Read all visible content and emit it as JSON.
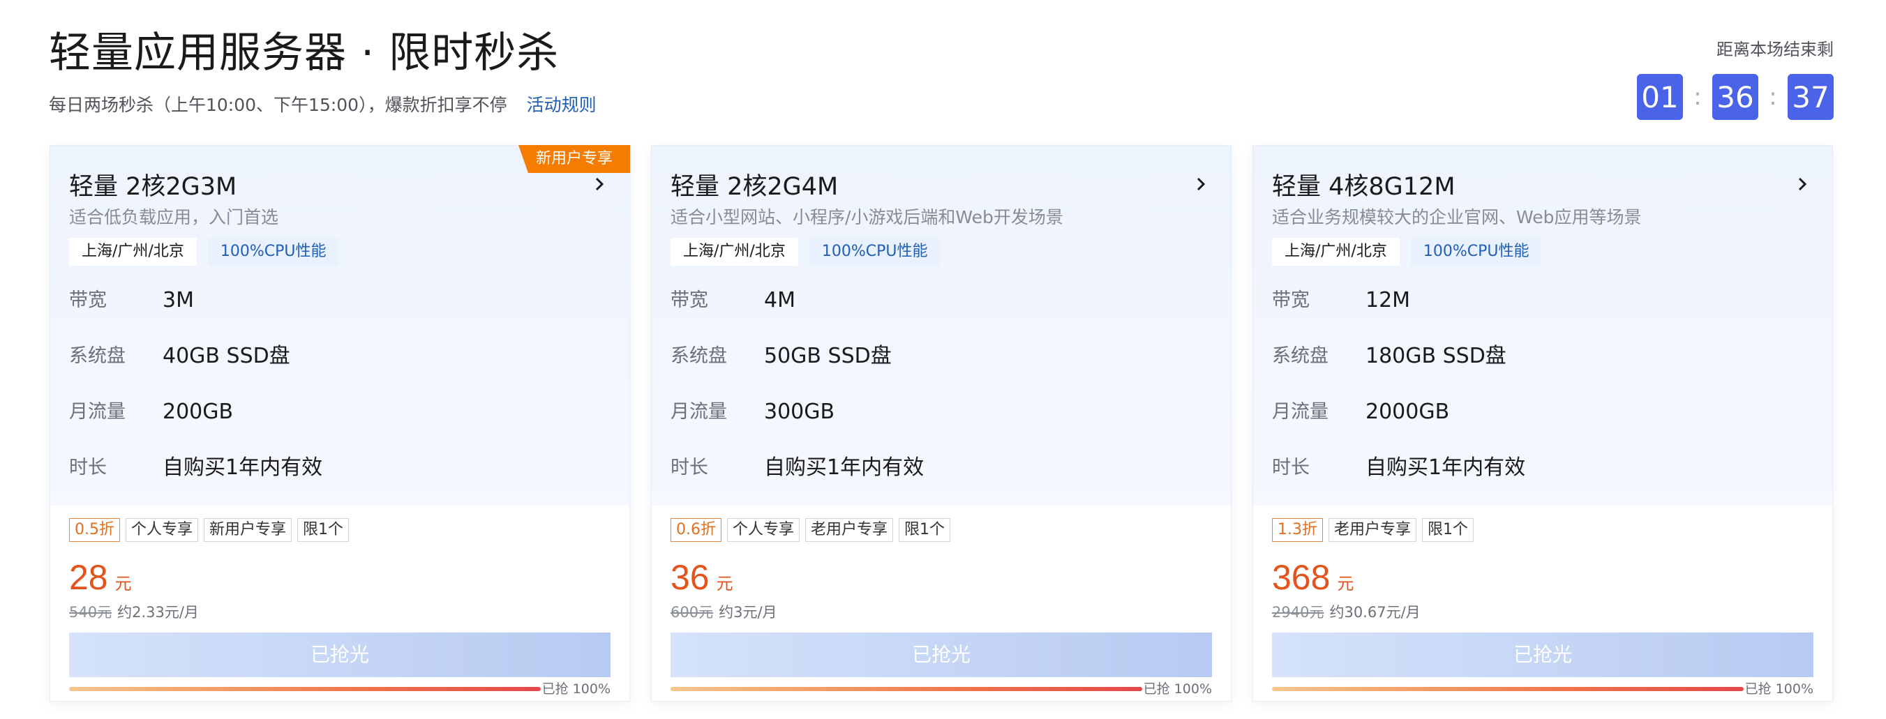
{
  "header": {
    "title": "轻量应用服务器 · 限时秒杀",
    "subtitle": "每日两场秒杀（上午10:00、下午15:00），爆款折扣享不停",
    "rules_link": "活动规则"
  },
  "countdown": {
    "label": "距离本场结束剩",
    "hours": "01",
    "minutes": "36",
    "seconds": "37",
    "separator": ":"
  },
  "colors": {
    "accent": "#4a63e8",
    "price": "#e5531c",
    "ribbon": "#f57c00",
    "link": "#1f5fb5"
  },
  "spec_labels": {
    "bandwidth": "带宽",
    "disk": "系统盘",
    "traffic": "月流量",
    "duration": "时长"
  },
  "cards": [
    {
      "ribbon": "新用户专享",
      "name": "轻量 2核2G3M",
      "desc": "适合低负载应用，入门首选",
      "tag_location": "上海/广州/北京",
      "tag_cpu": "100%CPU性能",
      "bandwidth": "3M",
      "disk": "40GB SSD盘",
      "traffic": "200GB",
      "duration": "自购买1年内有效",
      "badges": [
        "0.5折",
        "个人专享",
        "新用户专享",
        "限1个"
      ],
      "price": "28",
      "price_unit": "元",
      "original_price": "540元",
      "monthly": "约2.33元/月",
      "button": "已抢光",
      "progress": 1.0,
      "progress_text": "已抢 100%"
    },
    {
      "ribbon": "",
      "name": "轻量 2核2G4M",
      "desc": "适合小型网站、小程序/小游戏后端和Web开发场景",
      "tag_location": "上海/广州/北京",
      "tag_cpu": "100%CPU性能",
      "bandwidth": "4M",
      "disk": "50GB SSD盘",
      "traffic": "300GB",
      "duration": "自购买1年内有效",
      "badges": [
        "0.6折",
        "个人专享",
        "老用户专享",
        "限1个"
      ],
      "price": "36",
      "price_unit": "元",
      "original_price": "600元",
      "monthly": "约3元/月",
      "button": "已抢光",
      "progress": 1.0,
      "progress_text": "已抢 100%"
    },
    {
      "ribbon": "",
      "name": "轻量 4核8G12M",
      "desc": "适合业务规模较大的企业官网、Web应用等场景",
      "tag_location": "上海/广州/北京",
      "tag_cpu": "100%CPU性能",
      "bandwidth": "12M",
      "disk": "180GB SSD盘",
      "traffic": "2000GB",
      "duration": "自购买1年内有效",
      "badges": [
        "1.3折",
        "老用户专享",
        "限1个"
      ],
      "price": "368",
      "price_unit": "元",
      "original_price": "2940元",
      "monthly": "约30.67元/月",
      "button": "已抢光",
      "progress": 1.0,
      "progress_text": "已抢 100%"
    }
  ]
}
